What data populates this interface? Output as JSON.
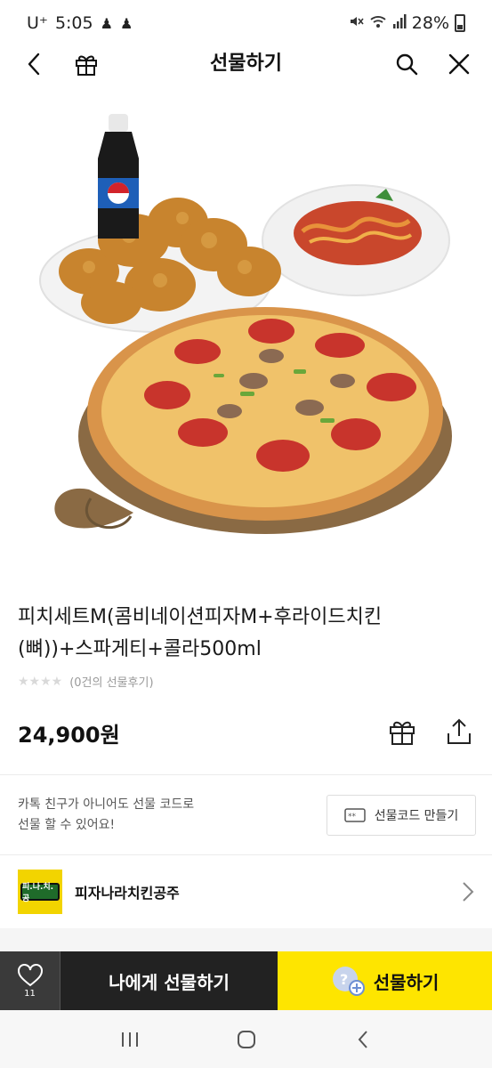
{
  "status_bar": {
    "carrier": "U⁺",
    "time": "5:05",
    "battery": "28%",
    "left_icons": [
      "notification-icon",
      "notification-icon"
    ],
    "right_icons": [
      "mute-icon",
      "wifi-icon",
      "signal-icon",
      "battery-icon"
    ]
  },
  "nav": {
    "title": "선물하기",
    "icons": [
      "back-icon",
      "gift-icon",
      "search-icon",
      "close-icon"
    ]
  },
  "product": {
    "title_line1": "피치세트M(콤비네이션피자M+후라이드치킨",
    "title_line2": "(뼈))+스파게티+콜라500ml",
    "review_text": "(0건의 선물후기)",
    "rating": 0,
    "price": "24,900원",
    "image_subject": "pizza-chicken-spaghetti-cola-set"
  },
  "gift_code": {
    "line1": "카톡 친구가 아니어도 선물 코드로",
    "line2": "선물 할 수 있어요!",
    "button_label": "선물코드 만들기"
  },
  "brand": {
    "name": "피자나라치킨공주",
    "logo_text": "피.나.치.공"
  },
  "action_bar": {
    "like_count": "11",
    "self_gift_label": "나에게 선물하기",
    "gift_label": "선물하기"
  },
  "colors": {
    "accent_yellow": "#fee500",
    "dark_button": "#222222",
    "like_bg": "#3a3a3a",
    "brand_logo_bg": "#f2d400"
  }
}
